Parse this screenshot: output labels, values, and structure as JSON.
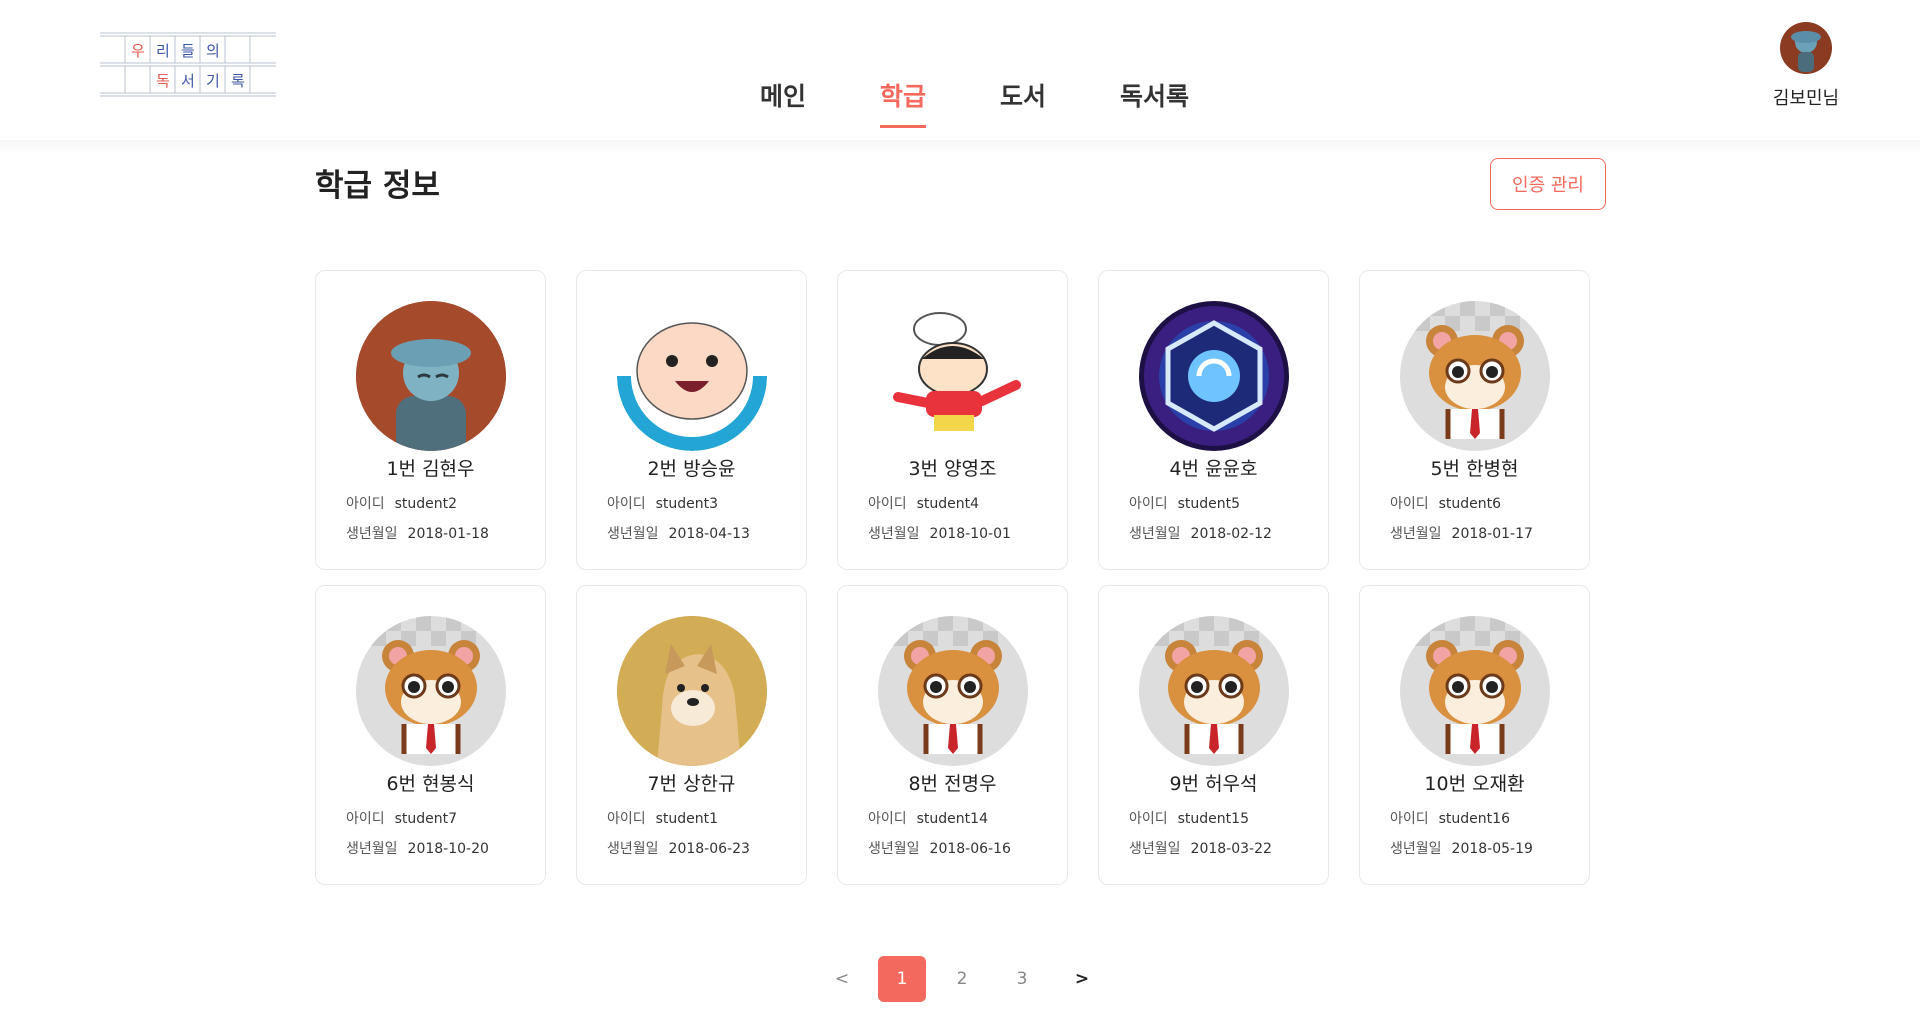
{
  "header": {
    "logo": {
      "line1": [
        "우",
        "리",
        "들",
        "의"
      ],
      "line2": [
        "독",
        "서",
        "기",
        "록"
      ]
    },
    "nav": [
      {
        "label": "메인",
        "active": false
      },
      {
        "label": "학급",
        "active": true
      },
      {
        "label": "도서",
        "active": false
      },
      {
        "label": "독서록",
        "active": false
      }
    ],
    "user": {
      "name": "김보민님"
    }
  },
  "main": {
    "title": "학급 정보",
    "cert_button": "인증 관리",
    "id_label": "아이디",
    "birth_label": "생년월일",
    "students": [
      {
        "name": "1번 김현우",
        "id": "student2",
        "birth": "2018-01-18",
        "avatar": "boy-illustration"
      },
      {
        "name": "2번 방승윤",
        "id": "student3",
        "birth": "2018-04-13",
        "avatar": "cartoon-face"
      },
      {
        "name": "3번 양영조",
        "id": "student4",
        "birth": "2018-10-01",
        "avatar": "cartoon-kid"
      },
      {
        "name": "4번 윤윤호",
        "id": "student5",
        "birth": "2018-02-12",
        "avatar": "hexagon-emblem"
      },
      {
        "name": "5번 한병현",
        "id": "student6",
        "birth": "2018-01-17",
        "avatar": "hamster"
      },
      {
        "name": "6번 현봉식",
        "id": "student7",
        "birth": "2018-10-20",
        "avatar": "hamster"
      },
      {
        "name": "7번 상한규",
        "id": "student1",
        "birth": "2018-06-23",
        "avatar": "dog-photo"
      },
      {
        "name": "8번 전명우",
        "id": "student14",
        "birth": "2018-06-16",
        "avatar": "hamster"
      },
      {
        "name": "9번 허우석",
        "id": "student15",
        "birth": "2018-03-22",
        "avatar": "hamster"
      },
      {
        "name": "10번 오재환",
        "id": "student16",
        "birth": "2018-05-19",
        "avatar": "hamster"
      }
    ]
  },
  "pagination": {
    "prev": "<",
    "pages": [
      "1",
      "2",
      "3"
    ],
    "current": "1",
    "next": ">"
  },
  "colors": {
    "accent": "#f4695d",
    "card_border": "#e8e8e8"
  }
}
